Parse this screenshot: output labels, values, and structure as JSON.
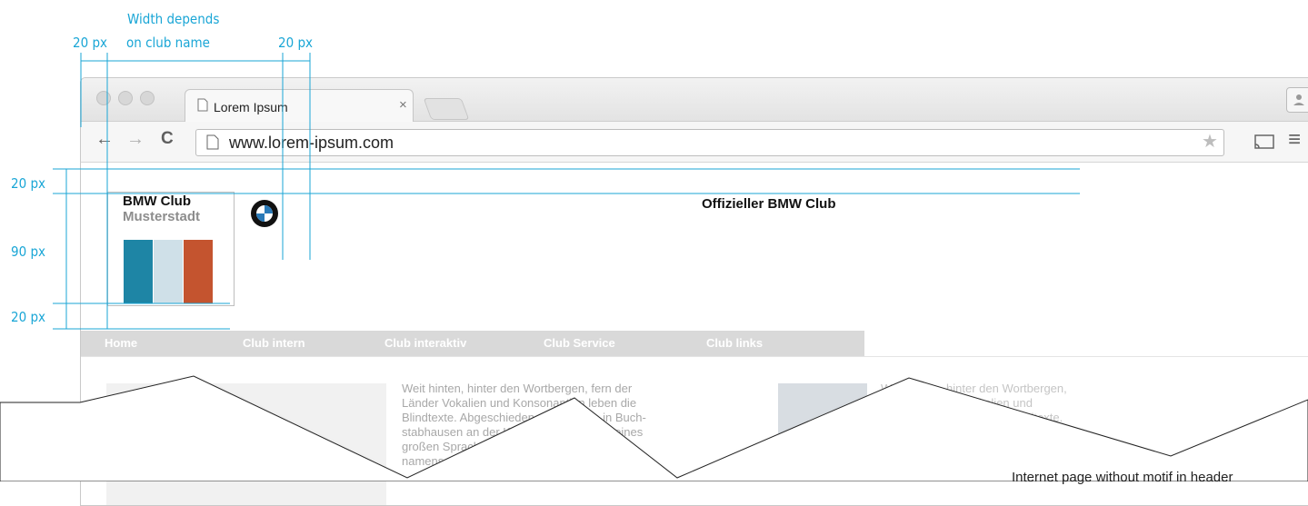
{
  "annotations": {
    "width_note_line1": "Width depends",
    "width_note_line2": "on club name",
    "left_margin": "20 px",
    "right_margin": "20 px",
    "top_margin": "20 px",
    "logo_height": "90 px",
    "bottom_margin": "20 px"
  },
  "browser": {
    "tab_title": "Lorem Ipsum",
    "tab_close": "×",
    "url": "www.lorem-ipsum.com",
    "back_icon": "←",
    "forward_icon": "→",
    "reload_icon": "C",
    "star_icon": "★",
    "menu_icon": "≡"
  },
  "page": {
    "club_name_line1": "BMW Club",
    "club_name_line2": "Musterstadt",
    "headline": "Offizieller BMW Club",
    "stripe_colors": [
      "#1e85a5",
      "#cfe0e8",
      "#c4542f"
    ],
    "nav": [
      "Home",
      "Club intern",
      "Club interaktiv",
      "Club Service",
      "Club links"
    ],
    "col1_text": [
      "Weit hinten, hinter den Wortbergen, fern der",
      "Länder Vokalien und Konsonantien leben die",
      "Blindtexte. Abgeschieden wohnen Sie in Buch-",
      "stabhausen an der Küste des Semantik, eines",
      "großen Sprachozeans. Ein kleines Bächlein",
      "namens"
    ],
    "col2_text": [
      "Weit hinten, hinter den Wortbergen,",
      "fern der Länder Vokalien und",
      "Konsonantien leben die Blindtexte."
    ]
  },
  "caption": "Internet page without motif in header"
}
